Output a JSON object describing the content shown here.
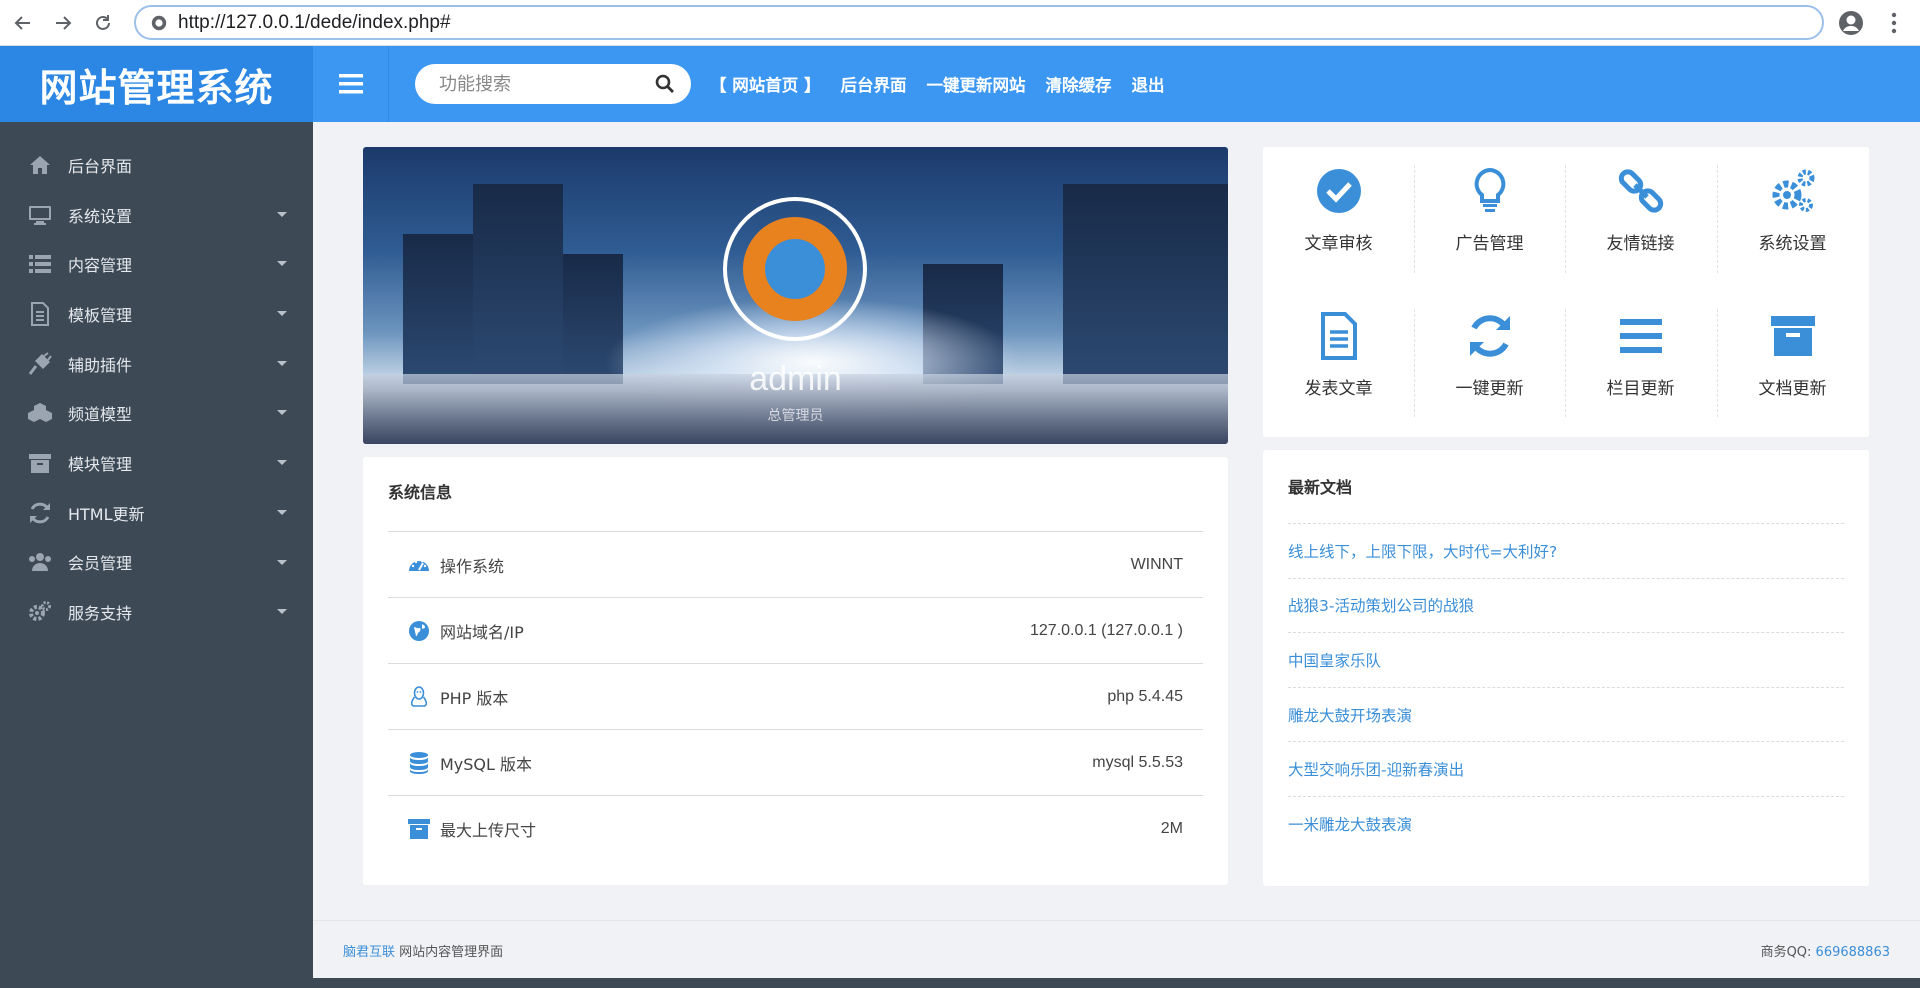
{
  "browser": {
    "url": "http://127.0.0.1/dede/index.php#"
  },
  "header": {
    "logo": "网站管理系统",
    "search_placeholder": "功能搜索",
    "links": [
      "【 网站首页 】",
      "后台界面",
      "一键更新网站",
      "清除缓存",
      "退出"
    ]
  },
  "sidebar": {
    "items": [
      {
        "label": "后台界面",
        "icon": "home-icon",
        "has_caret": false
      },
      {
        "label": "系统设置",
        "icon": "monitor-icon",
        "has_caret": true
      },
      {
        "label": "内容管理",
        "icon": "list-icon",
        "has_caret": true
      },
      {
        "label": "模板管理",
        "icon": "file-icon",
        "has_caret": true
      },
      {
        "label": "辅助插件",
        "icon": "plug-icon",
        "has_caret": true
      },
      {
        "label": "频道模型",
        "icon": "cubes-icon",
        "has_caret": true
      },
      {
        "label": "模块管理",
        "icon": "archive-icon",
        "has_caret": true
      },
      {
        "label": "HTML更新",
        "icon": "refresh-icon",
        "has_caret": true
      },
      {
        "label": "会员管理",
        "icon": "users-icon",
        "has_caret": true
      },
      {
        "label": "服务支持",
        "icon": "cogs-icon",
        "has_caret": true
      }
    ]
  },
  "banner": {
    "username": "admin",
    "role": "总管理员"
  },
  "quick": {
    "items": [
      {
        "label": "文章审核",
        "icon": "check-circle-icon"
      },
      {
        "label": "广告管理",
        "icon": "lightbulb-icon"
      },
      {
        "label": "友情链接",
        "icon": "link-icon"
      },
      {
        "label": "系统设置",
        "icon": "cogs-icon"
      },
      {
        "label": "发表文章",
        "icon": "document-icon"
      },
      {
        "label": "一键更新",
        "icon": "refresh-icon"
      },
      {
        "label": "栏目更新",
        "icon": "menu-icon"
      },
      {
        "label": "文档更新",
        "icon": "archive-icon"
      }
    ]
  },
  "sysinfo": {
    "title": "系统信息",
    "rows": [
      {
        "label": "操作系统",
        "value": "WINNT",
        "icon": "dashboard-icon"
      },
      {
        "label": "网站域名/IP",
        "value": "127.0.0.1 (127.0.0.1 )",
        "icon": "globe-icon"
      },
      {
        "label": "PHP 版本",
        "value": "php 5.4.45",
        "icon": "linux-icon"
      },
      {
        "label": "MySQL 版本",
        "value": "mysql 5.5.53",
        "icon": "database-icon"
      },
      {
        "label": "最大上传尺寸",
        "value": "2M",
        "icon": "archive-icon"
      }
    ]
  },
  "latest": {
    "title": "最新文档",
    "items": [
      "线上线下，上限下限，大时代=大利好?",
      "战狼3-活动策划公司的战狼",
      "中国皇家乐队",
      "雕龙大鼓开场表演",
      "大型交响乐团-迎新春演出",
      "一米雕龙大鼓表演"
    ]
  },
  "footer": {
    "brand": "脑君互联",
    "left_text": " 网站内容管理界面",
    "qq_label": "商务QQ: ",
    "qq": "669688863"
  },
  "colors": {
    "primary": "#3c97f3",
    "logo_bg": "#2b87e3",
    "sidebar_bg": "#3d4955",
    "link": "#3b8fd8",
    "avatar_orange": "#e8821f"
  }
}
